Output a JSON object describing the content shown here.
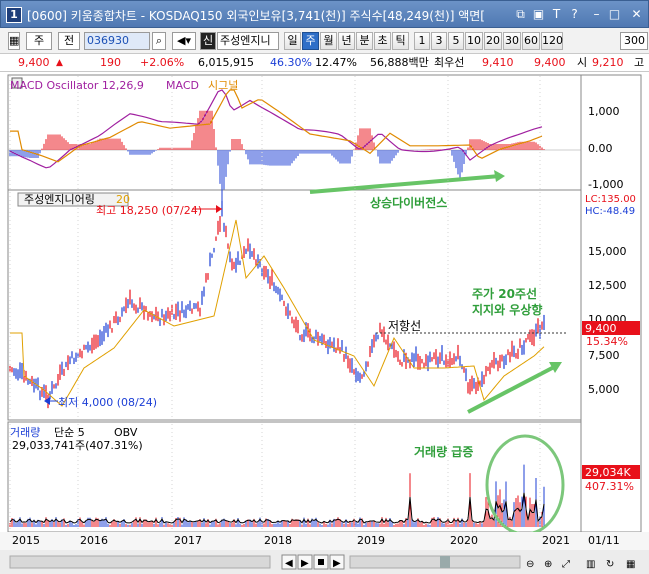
{
  "titlebar": {
    "num": "1",
    "title": "[0600] 키움종합차트 - KOSDAQ150 외국인보유[3,741(천)] 주식수[48,249(천)] 액면[",
    "icons": [
      "restore-window-icon",
      "dock-icon",
      "font-size-icon",
      "help-icon",
      "minimize-icon",
      "maximize-icon",
      "close-icon"
    ],
    "icon_glyphs": [
      "⧉",
      "▣",
      "T",
      "?",
      "–",
      "□",
      "✕"
    ]
  },
  "toolbar": {
    "btn1": "주",
    "btn2": "전",
    "code": "036930",
    "new_badge": "신",
    "stock_name": "주성엔지니",
    "periods": [
      "일",
      "주",
      "월",
      "년",
      "분",
      "초",
      "틱"
    ],
    "selected_period": "주",
    "intervals": [
      "1",
      "3",
      "5",
      "10",
      "20",
      "30",
      "60",
      "120"
    ],
    "count": "300"
  },
  "infobar": {
    "price": "9,400",
    "arrow": "▲",
    "change": "190",
    "change_pct": "+2.06%",
    "volume": "6,015,915",
    "pct1": "46.30%",
    "pct2": "12.47%",
    "amount": "56,888백만",
    "best_label": "최우선",
    "bid": "9,410",
    "ask": "9,400",
    "open_label": "시",
    "open": "9,210",
    "extra": "고"
  },
  "macd": {
    "label_name": "MACD Oscillator 12,26,9",
    "label_macd": "MACD",
    "label_signal": "시그널",
    "axis": [
      "1,000",
      "0.00",
      "-1,000"
    ],
    "annotation": "상승다이버전스"
  },
  "price_panel": {
    "legend_name": "주성엔지니어링",
    "legend_ma": "20",
    "high_note": "최고 18,250 (07/24)",
    "low_note": "최저 4,000 (08/24)",
    "resistance": "저항선",
    "support_note1": "주가 20주선",
    "support_note2": "지지와 우상향",
    "lc": "LC:135.00",
    "hc": "HC:-48.49",
    "axis": [
      "15,000",
      "12,500",
      "10,000",
      "7,500",
      "5,000"
    ],
    "last_price": "9,400",
    "last_pct": "15.34%"
  },
  "volume_panel": {
    "label_name": "거래량",
    "label_ma": "단순 5",
    "label_obv": "OBV",
    "value": "29,033,741주(407.31%)",
    "annotation": "거래량 급증",
    "last_vol": "29,034K",
    "last_pct": "407.31%"
  },
  "xaxis": {
    "years": [
      "2015",
      "2016",
      "2017",
      "2018",
      "2019",
      "2020",
      "2021"
    ],
    "right_date": "01/11"
  },
  "colors": {
    "up": "#e8101a",
    "down": "#1c3fd6",
    "macd_line": "#a020a0",
    "signal_line": "#e08a00",
    "annotation": "#2f9e3a",
    "ma20": "#e0a000"
  }
}
